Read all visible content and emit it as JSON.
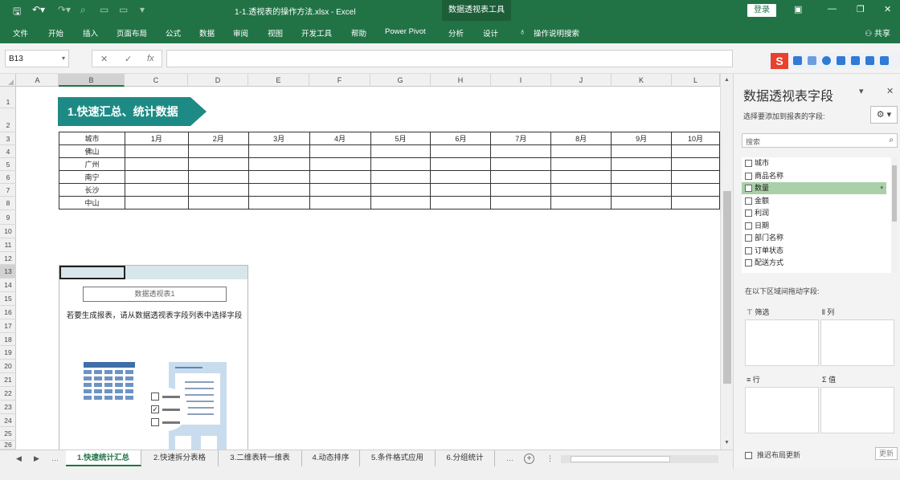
{
  "titlebar": {
    "document_title": "1-1.透视表的操作方法.xlsx - Excel",
    "context_tab": "数据透视表工具",
    "login_label": "登录",
    "save_icon": "save-icon",
    "undo_icon": "undo-icon",
    "redo_icon": "redo-icon"
  },
  "ribbon": {
    "tabs": [
      "文件",
      "开始",
      "插入",
      "页面布局",
      "公式",
      "数据",
      "审阅",
      "视图",
      "开发工具",
      "帮助",
      "Power Pivot",
      "分析",
      "设计"
    ],
    "tell_me": "操作说明搜索",
    "share": "共享"
  },
  "formula_bar": {
    "name_box": "B13",
    "cancel": "✕",
    "enter": "✓",
    "fx": "fx",
    "formula_value": ""
  },
  "columns": [
    "A",
    "B",
    "C",
    "D",
    "E",
    "F",
    "G",
    "H",
    "I",
    "J",
    "K",
    "L"
  ],
  "rows": [
    "1",
    "2",
    "3",
    "4",
    "5",
    "6",
    "7",
    "8",
    "9",
    "10",
    "11",
    "12",
    "13",
    "14",
    "15",
    "16",
    "17",
    "18",
    "19",
    "20",
    "21",
    "22",
    "23",
    "24",
    "25",
    "26"
  ],
  "sheet": {
    "banner": "1.快速汇总、统计数据",
    "table_header": [
      "城市",
      "1月",
      "2月",
      "3月",
      "4月",
      "5月",
      "6月",
      "7月",
      "8月",
      "9月",
      "10月"
    ],
    "table_rows": [
      "佛山",
      "广州",
      "南宁",
      "长沙",
      "中山"
    ],
    "pivot_placeholder": {
      "name": "数据透视表1",
      "description": "若要生成报表，请从数据透视表字段列表中选择字段"
    }
  },
  "sheet_tabs": [
    "1.快速统计汇总",
    "2.快速拆分表格",
    "3.二维表转一维表",
    "4.动态排序",
    "5.条件格式应用",
    "6.分组统计"
  ],
  "pane": {
    "title": "数据透视表字段",
    "subtitle": "选择要添加到报表的字段:",
    "search_placeholder": "搜索",
    "fields": [
      "城市",
      "商品名称",
      "数量",
      "金额",
      "利润",
      "日期",
      "部门名称",
      "订单状态",
      "配送方式"
    ],
    "highlighted_field_index": 2,
    "drag_label": "在以下区域间拖动字段:",
    "areas": {
      "filters": "筛选",
      "columns": "列",
      "rows": "行",
      "values": "值"
    },
    "defer_label": "推迟布局更新",
    "update_button": "更新"
  },
  "colors": {
    "excel_green": "#217346",
    "banner_teal": "#1e8a85",
    "highlight_green": "#a9d0a9",
    "ime_red": "#e8412c"
  }
}
